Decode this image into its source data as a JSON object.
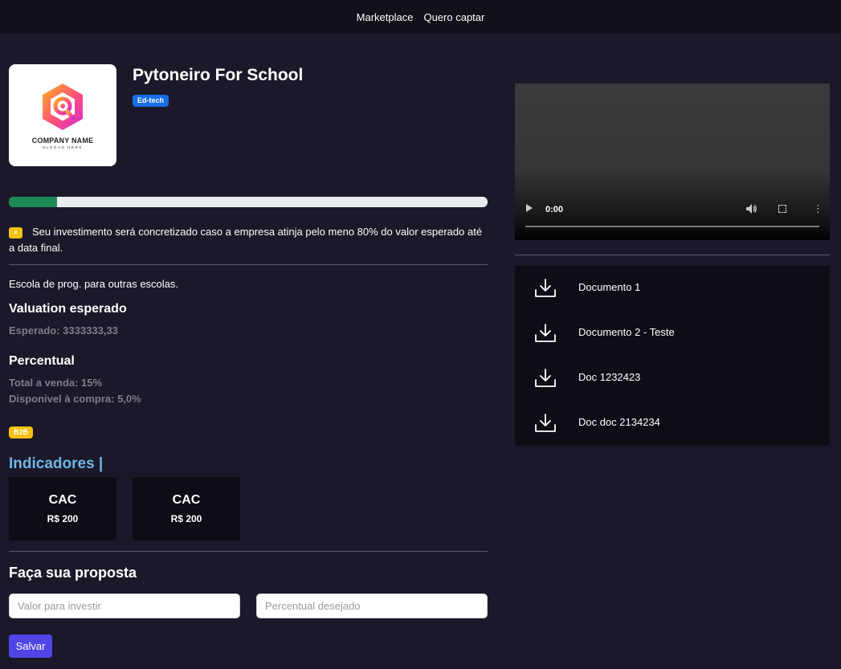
{
  "nav": {
    "items": [
      "Marketplace",
      "Quero captar"
    ]
  },
  "company": {
    "logo_text": "COMPANY NAME",
    "logo_slogan": "SLOGAN HERE",
    "title": "Pytoneiro For School",
    "sector": "Ed-tech",
    "progress_fraction": 0.1
  },
  "notice": {
    "icon_glyph": "×",
    "text": "Seu investimento será concretizado caso a empresa atinja pelo meno 80% do valor esperado até a data final."
  },
  "description": "Escola de prog. para outras escolas.",
  "valuation": {
    "heading": "Valuation esperado",
    "expected": "Esperado: 3333333,33"
  },
  "percentual": {
    "heading": "Percentual",
    "total": "Total a venda: 15%",
    "available": "Disponivel à compra: 5,0%"
  },
  "model_badge": "B2B",
  "indicators": {
    "heading": "Indicadores |",
    "items": [
      {
        "name": "CAC",
        "value": "R$ 200"
      },
      {
        "name": "CAC",
        "value": "R$ 200"
      }
    ]
  },
  "proposal": {
    "heading": "Faça sua proposta",
    "amount_placeholder": "Valor para investir",
    "percent_placeholder": "Percentual desejado",
    "save_label": "Salvar"
  },
  "video": {
    "time": "0:00"
  },
  "documents": [
    "Documento 1",
    "Documento 2 - Teste",
    "Doc 1232423",
    "Doc doc 2134234"
  ],
  "colors": {
    "background": "#1b1829",
    "nav": "#121019",
    "accent_button": "#5046e5",
    "progress": "#1f8a55",
    "sector_badge": "#1a6ee6",
    "warning": "#f5c211",
    "indicators_heading": "#6fb7e6"
  }
}
